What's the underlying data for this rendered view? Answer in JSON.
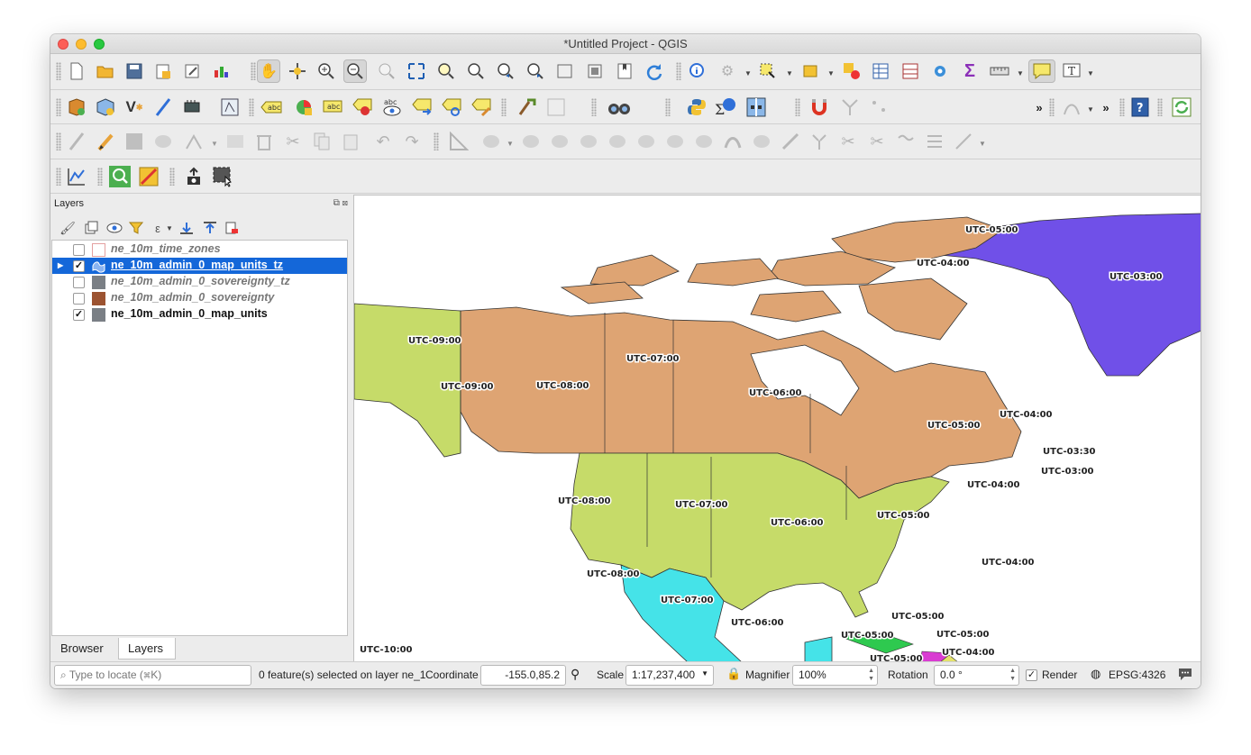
{
  "window": {
    "title": "*Untitled Project - QGIS"
  },
  "layers_panel": {
    "title": "Layers",
    "layers": [
      {
        "name": "ne_10m_time_zones",
        "checked": false,
        "swatch": "#ffffff",
        "italic": true,
        "selected": false
      },
      {
        "name": "ne_10m_admin_0_map_units_tz",
        "checked": true,
        "swatch": "#2f6fd8",
        "italic": false,
        "selected": true
      },
      {
        "name": "ne_10m_admin_0_sovereignty_tz",
        "checked": false,
        "swatch": "#7a7f85",
        "italic": true,
        "selected": false
      },
      {
        "name": "ne_10m_admin_0_sovereignty",
        "checked": false,
        "swatch": "#9c5331",
        "italic": true,
        "selected": false
      },
      {
        "name": "ne_10m_admin_0_map_units",
        "checked": true,
        "swatch": "#7a7f85",
        "italic": false,
        "selected": false
      }
    ],
    "tabs": [
      "Browser",
      "Layers"
    ],
    "active_tab": "Layers"
  },
  "toolbar": {
    "snap_tolerance": "12"
  },
  "map": {
    "colors": {
      "ocean": "#ffffff",
      "canada": "#dea473",
      "usa": "#c6db69",
      "mexico": "#45e3e8",
      "greenland": "#7050e8",
      "alaska": "#c6db69"
    },
    "labels": [
      "UTC-05:00",
      "UTC-04:00",
      "UTC-03:00",
      "UTC-09:00",
      "UTC-07:00",
      "UTC-09:00",
      "UTC-08:00",
      "UTC-06:00",
      "UTC-05:00",
      "UTC-04:00",
      "UTC-03:30",
      "UTC-03:00",
      "UTC-04:00",
      "UTC-08:00",
      "UTC-07:00",
      "UTC-06:00",
      "UTC-05:00",
      "UTC-04:00",
      "UTC-08:00",
      "UTC-07:00",
      "UTC-06:00",
      "UTC-05:00",
      "UTC-05:00",
      "UTC-05:00",
      "UTC-04:00",
      "UTC-05:00",
      "UTC-10:00"
    ]
  },
  "statusbar": {
    "locate_placeholder": "Type to locate (⌘K)",
    "selection_msg": "0 feature(s) selected on layer ne_1",
    "coordinate_label": "Coordinate",
    "coordinate": "-155.0,85.2",
    "scale_label": "Scale",
    "scale": "1:17,237,400",
    "magnifier_label": "Magnifier",
    "magnifier": "100%",
    "rotation_label": "Rotation",
    "rotation": "0.0 °",
    "render_label": "Render",
    "render_checked": true,
    "crs": "EPSG:4326"
  }
}
